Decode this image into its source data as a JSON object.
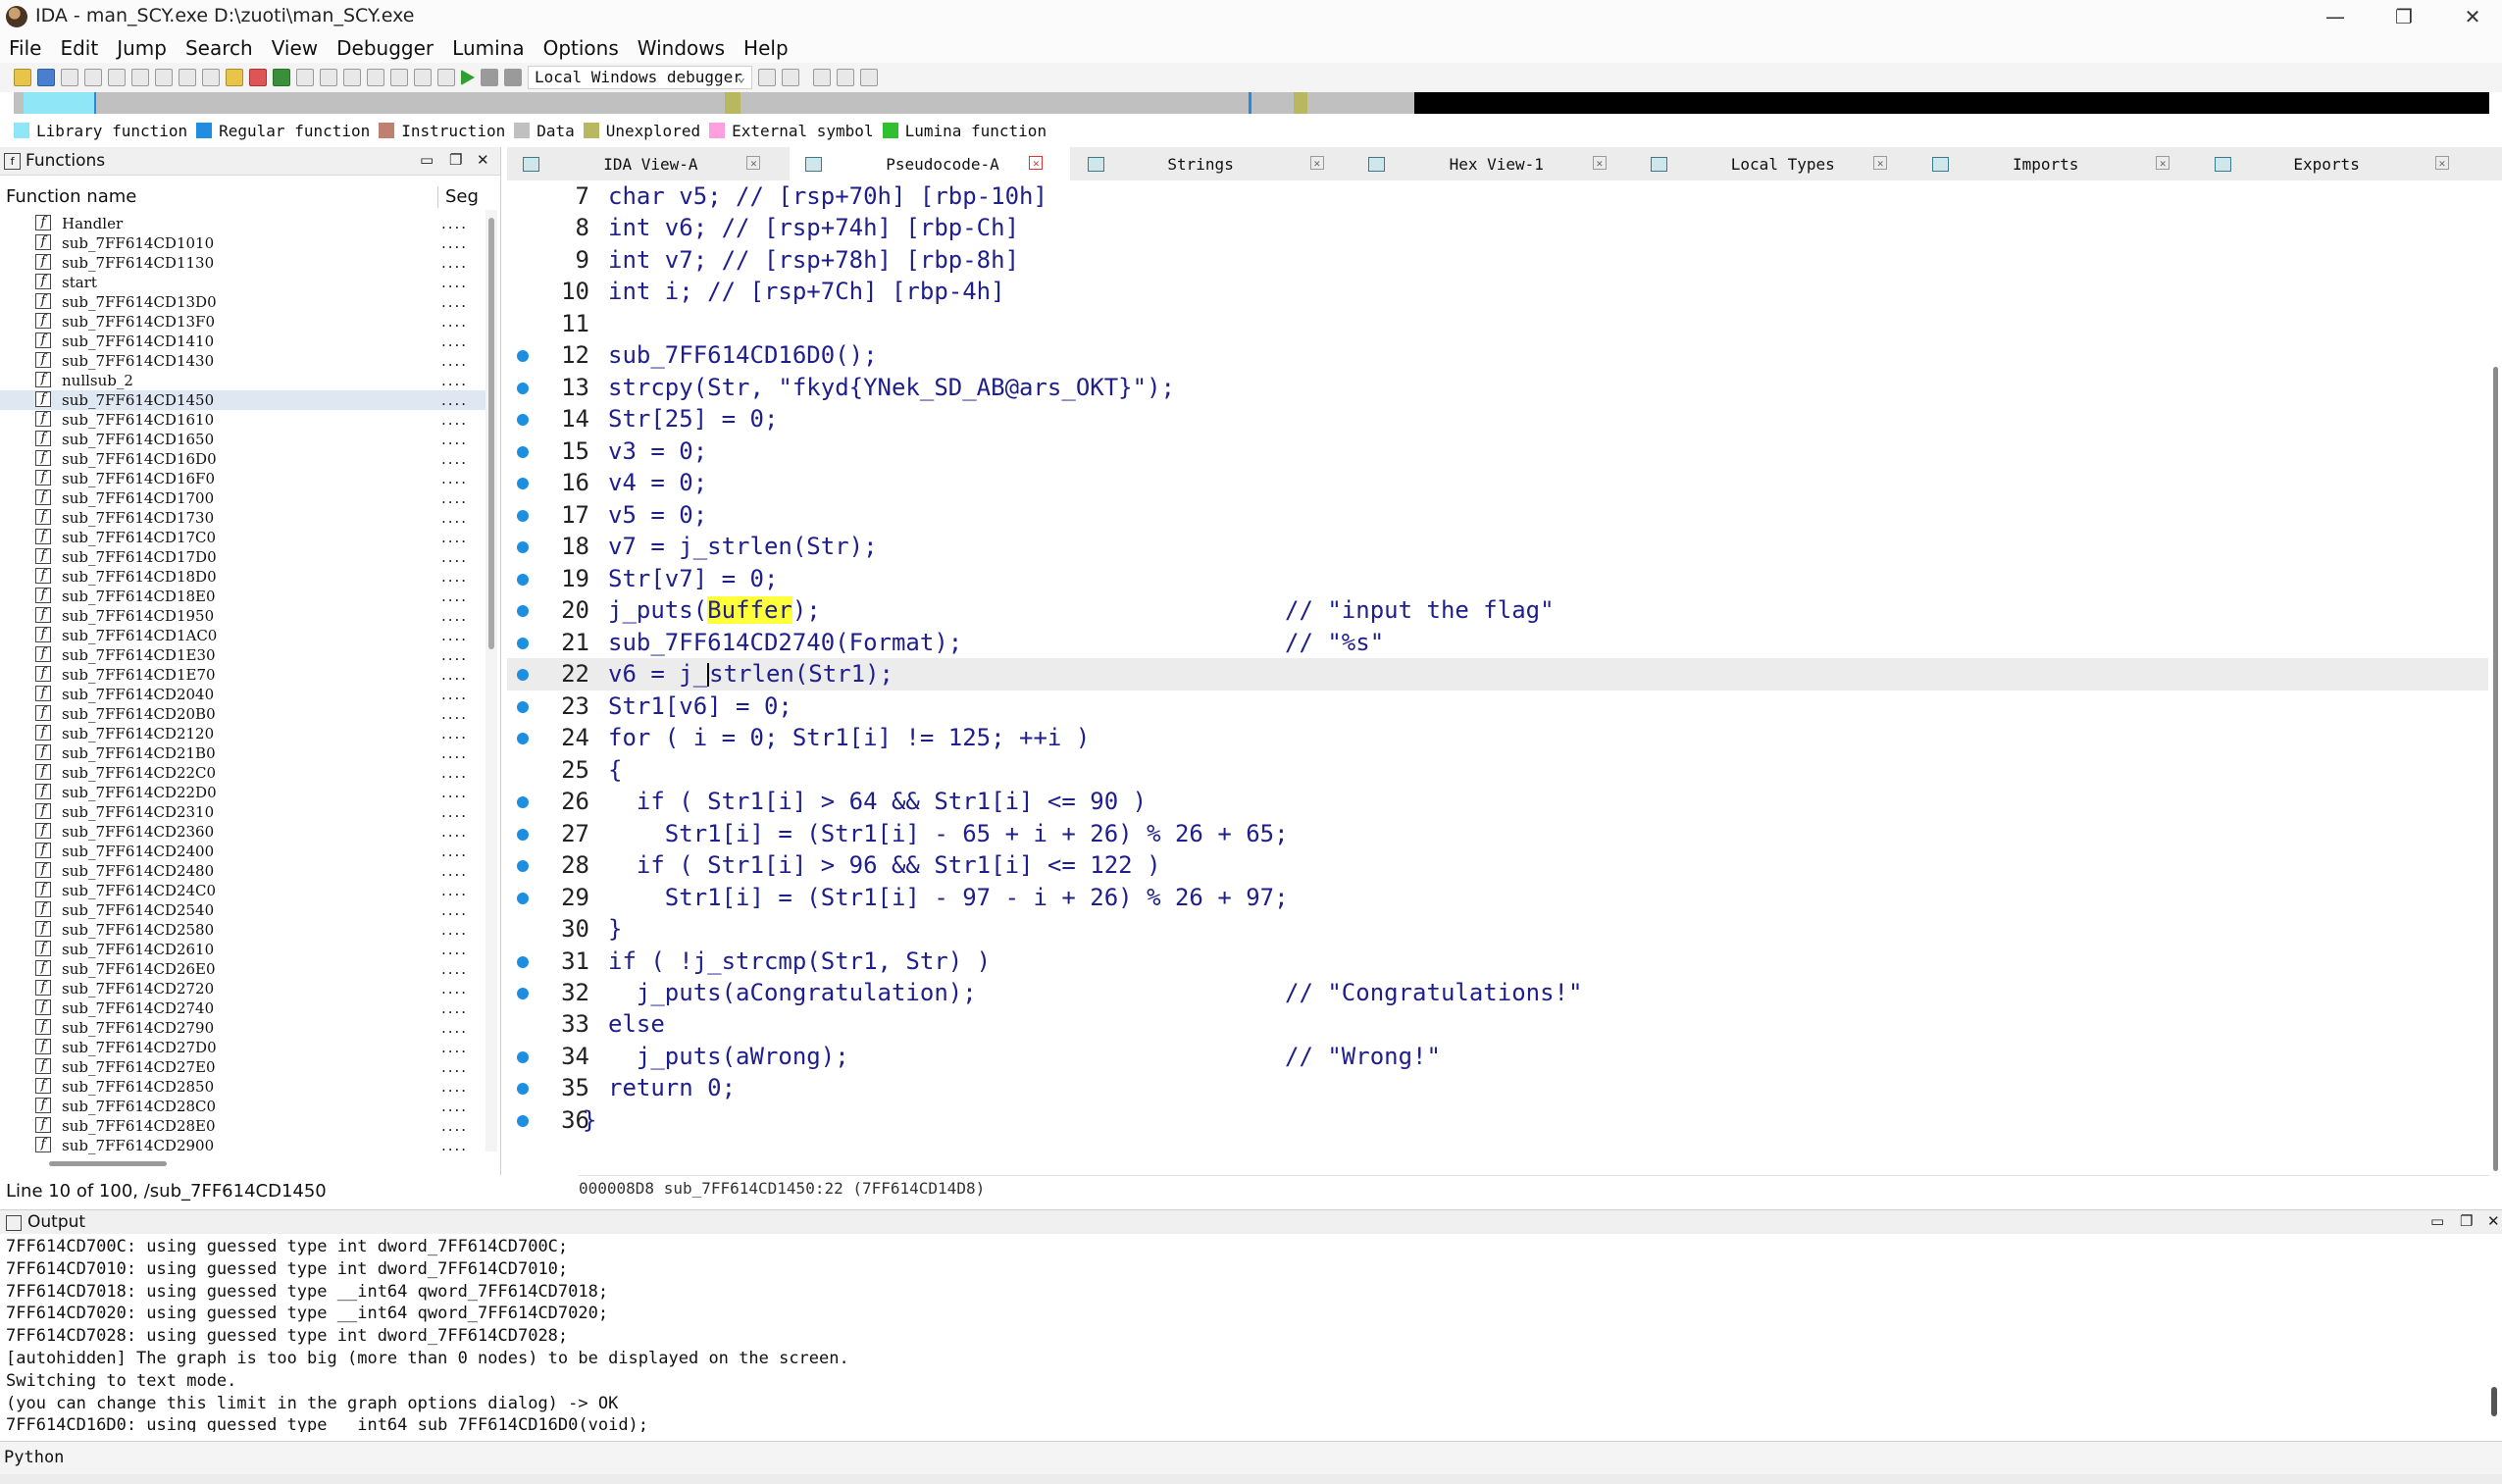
{
  "window": {
    "title": "IDA - man_SCY.exe D:\\zuoti\\man_SCY.exe",
    "controls": [
      "—",
      "❐",
      "✕"
    ]
  },
  "menu": [
    "File",
    "Edit",
    "Jump",
    "Search",
    "View",
    "Debugger",
    "Lumina",
    "Options",
    "Windows",
    "Help"
  ],
  "toolbar": {
    "debugger_select": "Local Windows debugger"
  },
  "legend": [
    {
      "label": "Library function",
      "color": "#8fe6f6"
    },
    {
      "label": "Regular function",
      "color": "#1f8ee0"
    },
    {
      "label": "Instruction",
      "color": "#c08070"
    },
    {
      "label": "Data",
      "color": "#c0c0c0"
    },
    {
      "label": "Unexplored",
      "color": "#b8b860"
    },
    {
      "label": "External symbol",
      "color": "#ff9fe0"
    },
    {
      "label": "Lumina function",
      "color": "#2fc02f"
    }
  ],
  "functions": {
    "title": "Functions",
    "col_name": "Function name",
    "col_seg": "Seg",
    "items": [
      "Handler",
      "sub_7FF614CD1010",
      "sub_7FF614CD1130",
      "start",
      "sub_7FF614CD13D0",
      "sub_7FF614CD13F0",
      "sub_7FF614CD1410",
      "sub_7FF614CD1430",
      "nullsub_2",
      "sub_7FF614CD1450",
      "sub_7FF614CD1610",
      "sub_7FF614CD1650",
      "sub_7FF614CD16D0",
      "sub_7FF614CD16F0",
      "sub_7FF614CD1700",
      "sub_7FF614CD1730",
      "sub_7FF614CD17C0",
      "sub_7FF614CD17D0",
      "sub_7FF614CD18D0",
      "sub_7FF614CD18E0",
      "sub_7FF614CD1950",
      "sub_7FF614CD1AC0",
      "sub_7FF614CD1E30",
      "sub_7FF614CD1E70",
      "sub_7FF614CD2040",
      "sub_7FF614CD20B0",
      "sub_7FF614CD2120",
      "sub_7FF614CD21B0",
      "sub_7FF614CD22C0",
      "sub_7FF614CD22D0",
      "sub_7FF614CD2310",
      "sub_7FF614CD2360",
      "sub_7FF614CD2400",
      "sub_7FF614CD2480",
      "sub_7FF614CD24C0",
      "sub_7FF614CD2540",
      "sub_7FF614CD2580",
      "sub_7FF614CD2610",
      "sub_7FF614CD26E0",
      "sub_7FF614CD2720",
      "sub_7FF614CD2740",
      "sub_7FF614CD2790",
      "sub_7FF614CD27D0",
      "sub_7FF614CD27E0",
      "sub_7FF614CD2850",
      "sub_7FF614CD28C0",
      "sub_7FF614CD28E0",
      "sub_7FF614CD2900"
    ],
    "selected_index": 9,
    "seg_value": "....",
    "status": "Line 10 of 100, /sub_7FF614CD1450"
  },
  "tabs": [
    {
      "label": "IDA View-A",
      "active": false
    },
    {
      "label": "Pseudocode-A",
      "active": true
    },
    {
      "label": "Strings",
      "active": false
    },
    {
      "label": "Hex View-1",
      "active": false
    },
    {
      "label": "Local Types",
      "active": false
    },
    {
      "label": "Imports",
      "active": false
    },
    {
      "label": "Exports",
      "active": false
    }
  ],
  "code": {
    "lines": [
      {
        "n": "7",
        "dot": false,
        "text": "char v5; // [rsp+70h] [rbp-10h]"
      },
      {
        "n": "8",
        "dot": false,
        "text": "int v6; // [rsp+74h] [rbp-Ch]"
      },
      {
        "n": "9",
        "dot": false,
        "text": "int v7; // [rsp+78h] [rbp-8h]"
      },
      {
        "n": "10",
        "dot": false,
        "text": "int i; // [rsp+7Ch] [rbp-4h]"
      },
      {
        "n": "11",
        "dot": false,
        "text": ""
      },
      {
        "n": "12",
        "dot": true,
        "text": "sub_7FF614CD16D0();"
      },
      {
        "n": "13",
        "dot": true,
        "text": "strcpy(Str, \"fkyd{YNek_SD_AB@ars_OKT}\");"
      },
      {
        "n": "14",
        "dot": true,
        "text": "Str[25] = 0;"
      },
      {
        "n": "15",
        "dot": true,
        "text": "v3 = 0;"
      },
      {
        "n": "16",
        "dot": true,
        "text": "v4 = 0;"
      },
      {
        "n": "17",
        "dot": true,
        "text": "v5 = 0;"
      },
      {
        "n": "18",
        "dot": true,
        "text": "v7 = j_strlen(Str);"
      },
      {
        "n": "19",
        "dot": true,
        "text": "Str[v7] = 0;"
      },
      {
        "n": "20",
        "dot": true,
        "text": "j_puts(Buffer);",
        "comment": "// \"input the flag\""
      },
      {
        "n": "21",
        "dot": true,
        "text": "sub_7FF614CD2740(Format);",
        "comment": "// \"%s\""
      },
      {
        "n": "22",
        "dot": true,
        "text": "v6 = j_strlen(Str1);",
        "current": true
      },
      {
        "n": "23",
        "dot": true,
        "text": "Str1[v6] = 0;"
      },
      {
        "n": "24",
        "dot": true,
        "text": "for ( i = 0; Str1[i] != 125; ++i )"
      },
      {
        "n": "25",
        "dot": false,
        "text": "{"
      },
      {
        "n": "26",
        "dot": true,
        "text": "  if ( Str1[i] > 64 && Str1[i] <= 90 )"
      },
      {
        "n": "27",
        "dot": true,
        "text": "    Str1[i] = (Str1[i] - 65 + i + 26) % 26 + 65;"
      },
      {
        "n": "28",
        "dot": true,
        "text": "  if ( Str1[i] > 96 && Str1[i] <= 122 )"
      },
      {
        "n": "29",
        "dot": true,
        "text": "    Str1[i] = (Str1[i] - 97 - i + 26) % 26 + 97;"
      },
      {
        "n": "30",
        "dot": false,
        "text": "}"
      },
      {
        "n": "31",
        "dot": true,
        "text": "if ( !j_strcmp(Str1, Str) )"
      },
      {
        "n": "32",
        "dot": true,
        "text": "  j_puts(aCongratulation);",
        "comment": "// \"Congratulations!\""
      },
      {
        "n": "33",
        "dot": false,
        "text": "else"
      },
      {
        "n": "34",
        "dot": true,
        "text": "  j_puts(aWrong);",
        "comment": "// \"Wrong!\""
      },
      {
        "n": "35",
        "dot": true,
        "text": "return 0;"
      },
      {
        "n": "36",
        "dot": true,
        "text": "}",
        "outdent": true
      }
    ],
    "status": "000008D8 sub_7FF614CD1450:22 (7FF614CD14D8)"
  },
  "output": {
    "title": "Output",
    "lines": [
      "7FF614CD700C: using guessed type int dword_7FF614CD700C;",
      "7FF614CD7010: using guessed type int dword_7FF614CD7010;",
      "7FF614CD7018: using guessed type __int64 qword_7FF614CD7018;",
      "7FF614CD7020: using guessed type __int64 qword_7FF614CD7020;",
      "7FF614CD7028: using guessed type int dword_7FF614CD7028;",
      "[autohidden] The graph is too big (more than 0 nodes) to be displayed on the screen.",
      "Switching to text mode.",
      "(you can change this limit in the graph options dialog) -> OK",
      "7FF614CD16D0: using guessed type __int64 sub_7FF614CD16D0(void);"
    ],
    "python_label": "Python"
  }
}
